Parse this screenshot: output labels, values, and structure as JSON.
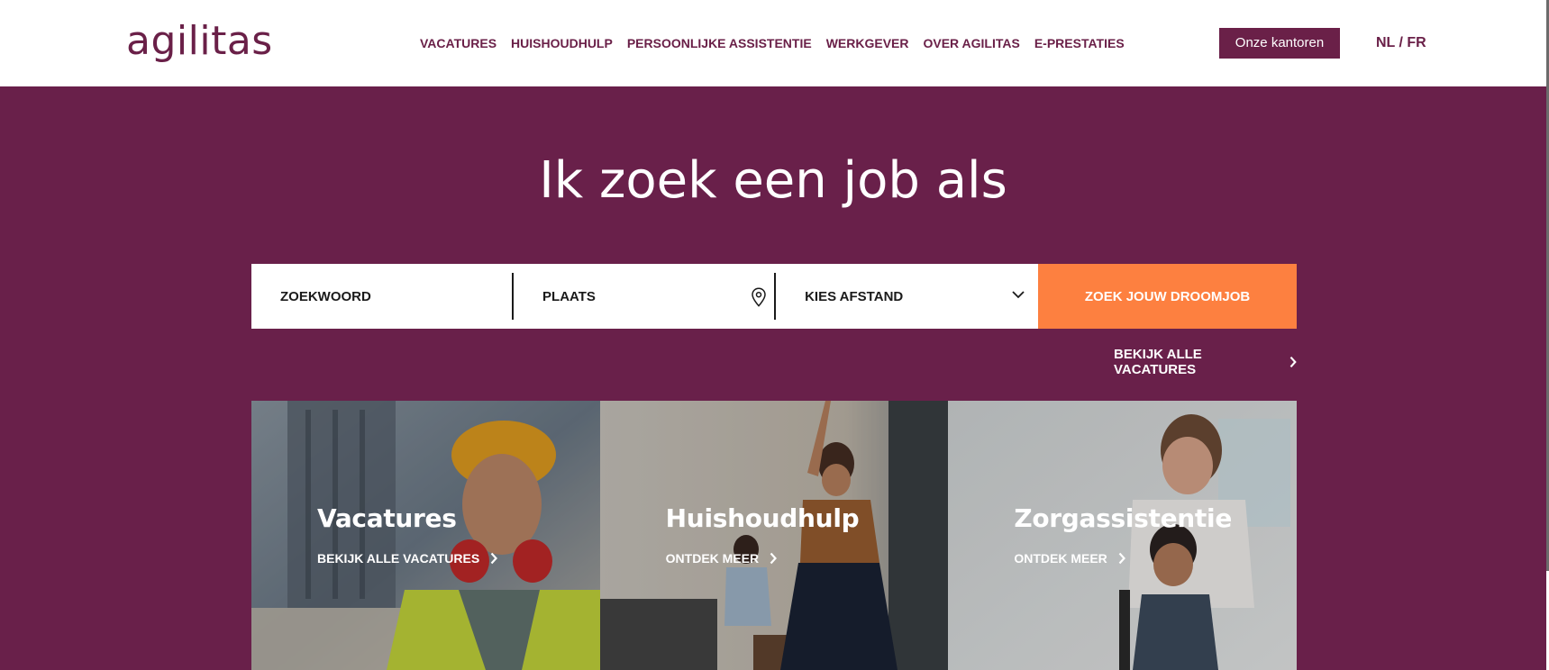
{
  "header": {
    "logo": "agilitas",
    "nav": [
      "VACATURES",
      "HUISHOUDHULP",
      "PERSOONLIJKE ASSISTENTIE",
      "WERKGEVER",
      "OVER AGILITAS",
      "E-PRESTATIES"
    ],
    "offices_button": "Onze kantoren",
    "lang_nl": "NL",
    "lang_sep": " / ",
    "lang_fr": "FR"
  },
  "hero": {
    "title": "Ik zoek een job als",
    "search": {
      "keyword_placeholder": "ZOEKWOORD",
      "place_placeholder": "PLAATS",
      "distance_label": "KIES AFSTAND",
      "button": "ZOEK JOUW DROOMJOB"
    },
    "all_jobs_link": "BEKIJK ALLE VACATURES"
  },
  "cards": [
    {
      "title": "Vacatures",
      "link": "BEKIJK ALLE VACATURES"
    },
    {
      "title": "Huishoudhulp",
      "link": "ONTDEK MEER"
    },
    {
      "title": "Zorgassistentie",
      "link": "ONTDEK MEER"
    }
  ],
  "colors": {
    "brand": "#69204a",
    "accent": "#fd8040"
  },
  "icons": [
    "location-pin-icon",
    "chevron-down-icon",
    "chevron-right-icon"
  ]
}
